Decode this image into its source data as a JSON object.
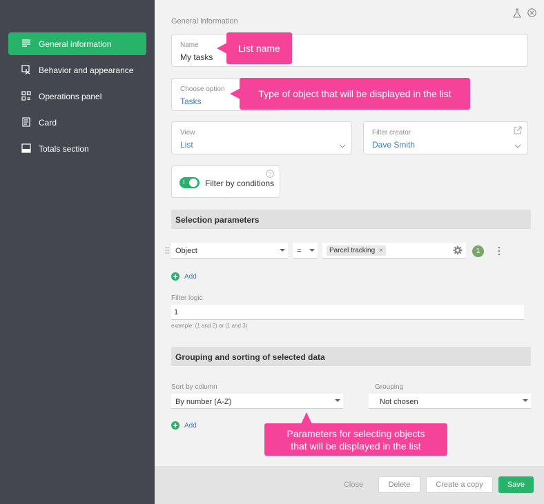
{
  "sidebar": {
    "items": [
      {
        "label": "General information",
        "icon": "lines-icon",
        "active": true
      },
      {
        "label": "Behavior and appearance",
        "icon": "pointer-icon",
        "active": false
      },
      {
        "label": "Operations panel",
        "icon": "grid-icon",
        "active": false
      },
      {
        "label": "Card",
        "icon": "card-icon",
        "active": false
      },
      {
        "label": "Totals section",
        "icon": "totals-icon",
        "active": false
      }
    ]
  },
  "header": {
    "section_title": "General information"
  },
  "form": {
    "name": {
      "label": "Name",
      "value": "My tasks"
    },
    "choose_option": {
      "label": "Choose option",
      "value": "Tasks"
    },
    "view": {
      "label": "View",
      "value": "List"
    },
    "filter_creator": {
      "label": "Filter creator",
      "value": "Dave Smith"
    },
    "filter_toggle": {
      "label": "Filter by conditions",
      "on": true,
      "knob_text": "I"
    }
  },
  "selection": {
    "title": "Selection parameters",
    "row": {
      "field": "Object",
      "operator": "=",
      "tag": "Parcel tracking",
      "count": "1"
    },
    "add_label": "Add",
    "filter_logic": {
      "label": "Filter logic",
      "value": "1",
      "hint": "example: (1 and 2) or (1 and 3)"
    }
  },
  "grouping": {
    "title": "Grouping and sorting of selected data",
    "sort_label": "Sort by column",
    "sort_value": "By number (A-Z)",
    "grouping_label": "Grouping",
    "grouping_value": "Not chosen",
    "add_label": "Add"
  },
  "tooltips": {
    "list_name": "List name",
    "object_type": "Type of object that will be displayed in the list",
    "params_line1": "Parameters for selecting objects",
    "params_line2": "that will be displayed in the list"
  },
  "footer": {
    "close": "Close",
    "delete": "Delete",
    "copy": "Create a copy",
    "save": "Save"
  },
  "colors": {
    "accent": "#27b46a",
    "tooltip": "#f5439a",
    "sidebar": "#44474f",
    "link": "#3d7fbc"
  }
}
